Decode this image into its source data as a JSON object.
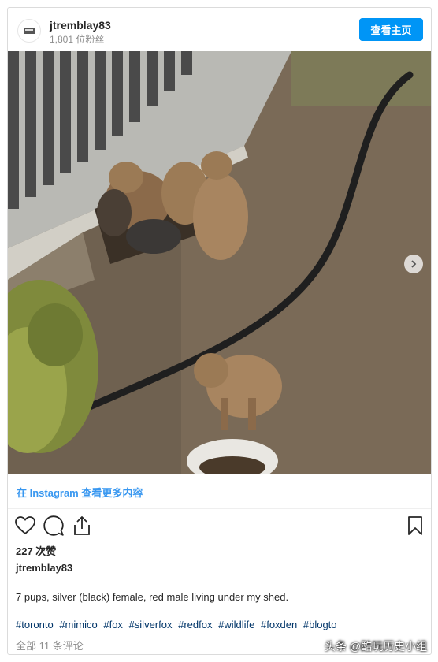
{
  "header": {
    "username": "jtremblay83",
    "followers": "1,801 位粉丝",
    "follow_label": "查看主页"
  },
  "photo": {
    "icon": "fox-pups-photo",
    "carousel_next_icon": "chevron-right-icon"
  },
  "view_more": "在 Instagram 查看更多内容",
  "actions": {
    "like_icon": "heart-icon",
    "comment_icon": "comment-icon",
    "share_icon": "share-icon",
    "save_icon": "bookmark-icon"
  },
  "likes": "227 次赞",
  "author": "jtremblay83",
  "caption": "7 pups, silver (black) female, red male living under my shed.",
  "hashtags": [
    "#toronto",
    "#mimico",
    "#fox",
    "#silverfox",
    "#redfox",
    "#wildlife",
    "#foxden",
    "#blogto"
  ],
  "comments": "全部 11 条评论",
  "watermark": "头条 @酷玩历史小组",
  "colors": {
    "accent": "#0095f6",
    "link": "#3897f0",
    "hashtag": "#003569"
  }
}
